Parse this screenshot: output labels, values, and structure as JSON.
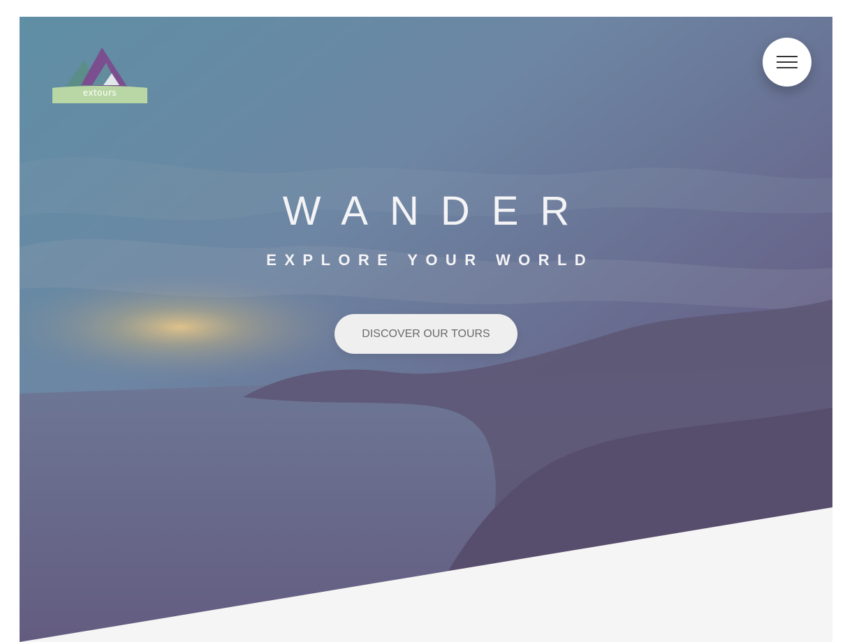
{
  "logo": {
    "text": "extours"
  },
  "header": {
    "menu_icon": "hamburger-menu-icon"
  },
  "hero": {
    "title": "WANDER",
    "subtitle": "EXPLORE YOUR WORLD",
    "cta_label": "DISCOVER OUR TOURS"
  },
  "colors": {
    "overlay_top": "#5e8fa3",
    "overlay_bottom": "#5f5477",
    "button_bg": "#efefef",
    "button_text": "#6a6a6a",
    "section_bg": "#f5f5f5",
    "logo_green": "#b9d7a4",
    "logo_purple": "#7a4f8e"
  }
}
